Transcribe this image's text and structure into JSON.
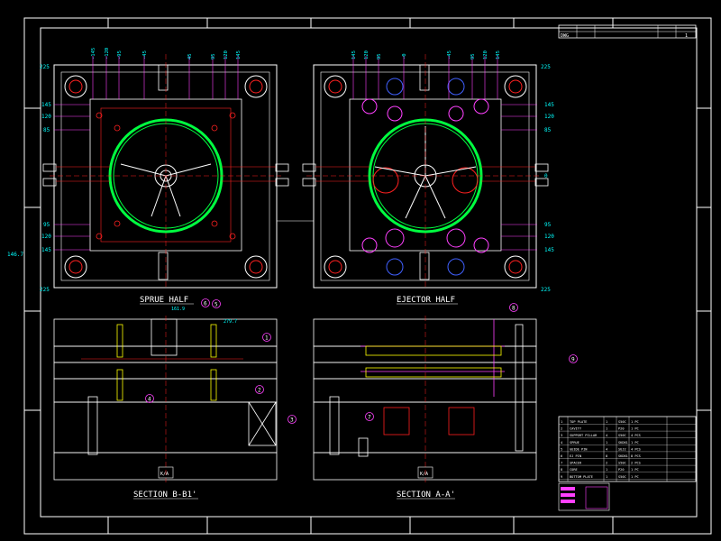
{
  "title_block": {
    "header_left": "DWG",
    "header_mid": "",
    "header_right_1": "",
    "header_right_2": "1"
  },
  "views": {
    "sprue_half": "SPRUE HALF",
    "ejector_half": "EJECTOR HALF",
    "section_b": "SECTION B-B1'",
    "section_a": "SECTION A-A'"
  },
  "dims_left": {
    "d225_top": "225",
    "d145": "145",
    "d120": "120",
    "d85": "85",
    "d95": "95",
    "d120b": "120",
    "d145b": "145",
    "d225_bot": "225",
    "d146": "146.7"
  },
  "dims_right": {
    "d225_top": "225",
    "d145": "145",
    "d120": "120",
    "d85": "85",
    "d0": "0",
    "d95": "95",
    "d120b": "120",
    "d145b": "145",
    "d225_bot": "225"
  },
  "top_dims_left": [
    "-145",
    "-120",
    "-95",
    "-45",
    "45",
    "95",
    "120",
    "145"
  ],
  "top_dims_right": [
    "145",
    "120",
    "95",
    "-0",
    "-45",
    "95",
    "120",
    "145"
  ],
  "callouts": [
    "1",
    "2",
    "3",
    "4",
    "5",
    "6",
    "7",
    "8",
    "9"
  ],
  "section_labels": {
    "kl_left": "K/A",
    "kl_right": "K/A",
    "d161": "161.9",
    "d279": "279.7"
  },
  "parts_list": [
    [
      "1",
      "TOP PLATE",
      "1",
      "S50C",
      "1 PC"
    ],
    [
      "2",
      "CAVITY",
      "1",
      "P20",
      "1 PC"
    ],
    [
      "3",
      "SUPPORT PILLAR",
      "4",
      "S50C",
      "4 PCS"
    ],
    [
      "4",
      "SPRUE",
      "1",
      "SKD61",
      "1 PC"
    ],
    [
      "5",
      "GUIDE PIN",
      "4",
      "SUJ2",
      "4 PCS"
    ],
    [
      "6",
      "EJ PIN",
      "8",
      "SKD61",
      "8 PCS"
    ],
    [
      "7",
      "SPACER",
      "2",
      "S50C",
      "2 PCS"
    ],
    [
      "8",
      "CORE",
      "1",
      "P20",
      "1 PC"
    ],
    [
      "9",
      "BOTTOM PLATE",
      "1",
      "S50C",
      "1 PC"
    ]
  ],
  "colors": {
    "line_white": "#ffffff",
    "red": "#ff2020",
    "green": "#00ff40",
    "magenta": "#ff40ff",
    "cyan": "#00ffff",
    "yellow": "#ffff00",
    "blue": "#4060ff"
  }
}
